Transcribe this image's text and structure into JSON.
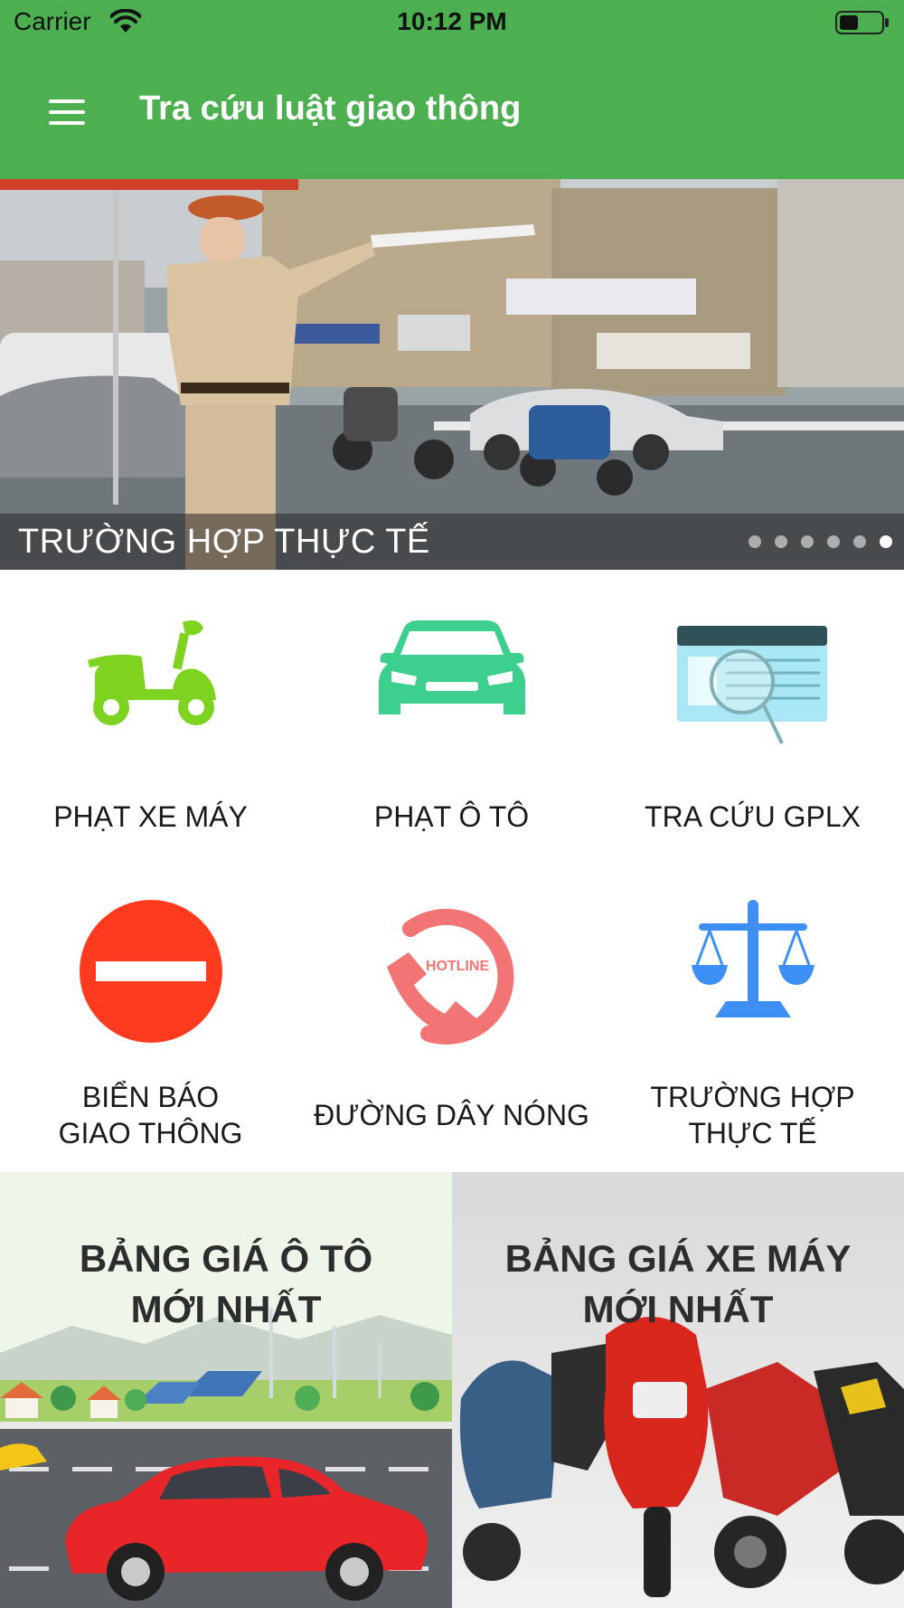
{
  "status": {
    "carrier": "Carrier",
    "time": "10:12 PM"
  },
  "header": {
    "title": "Tra cứu luật giao thông"
  },
  "banner": {
    "caption": "TRƯỜNG HỢP THỰC TẾ",
    "slide_count": 6,
    "active_slide": 6
  },
  "menu": [
    {
      "label": "PHẠT XE MÁY",
      "icon": "scooter-icon"
    },
    {
      "label": "PHẠT Ô TÔ",
      "icon": "car-icon"
    },
    {
      "label": "TRA CỨU GPLX",
      "icon": "license-search-icon"
    },
    {
      "label_lines": [
        "BIỂN BÁO",
        "GIAO THÔNG"
      ],
      "icon": "no-entry-sign-icon"
    },
    {
      "label": "ĐƯỜNG DÂY NÓNG",
      "icon": "hotline-phone-icon",
      "icon_text": "HOTLINE"
    },
    {
      "label_lines": [
        "TRƯỜNG HỢP",
        "THỰC TẾ"
      ],
      "icon": "scales-icon"
    }
  ],
  "promos": [
    {
      "title_lines": [
        "BẢNG GIÁ Ô TÔ",
        "MỚI NHẤT"
      ]
    },
    {
      "title_lines": [
        "BẢNG GIÁ XE MÁY",
        "MỚI NHẤT"
      ]
    }
  ],
  "colors": {
    "app_bar": "#4caf50",
    "scooter": "#7ed321",
    "car": "#3dcf8e",
    "no_entry": "#ff3b1f",
    "hotline": "#f27474",
    "scales": "#3d8ff5"
  }
}
